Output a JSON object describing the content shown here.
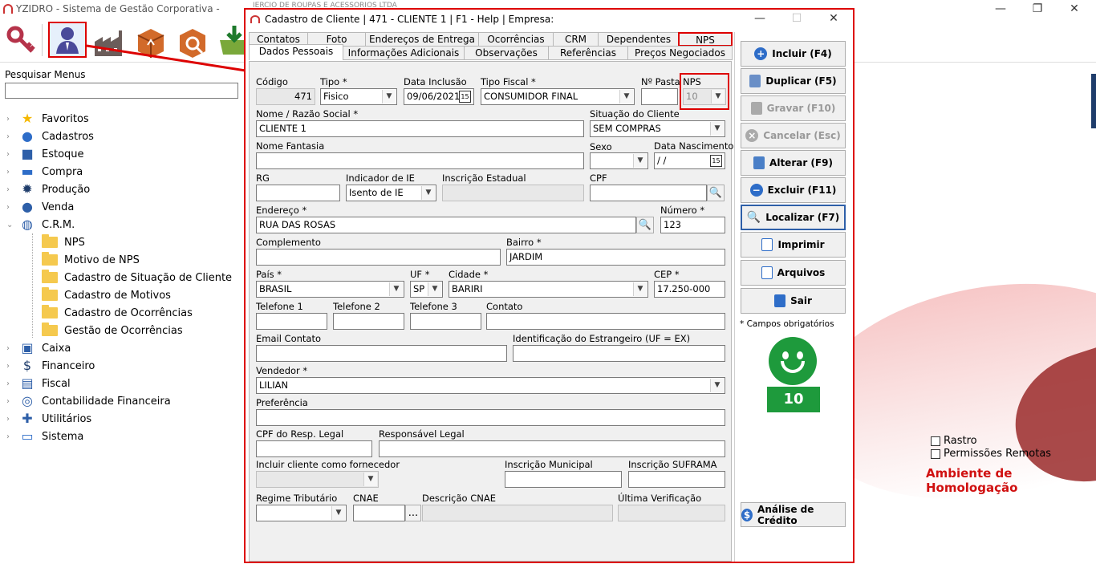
{
  "app": {
    "title": "YZIDRO - Sistema de Gestão Corporativa -",
    "company_partial": "IERCIO DE ROUPAS E ACESSORIOS LTDA"
  },
  "window_controls": {
    "minimize": "—",
    "maximize": "❐",
    "close": "✕"
  },
  "toolbar": {
    "icons": [
      "key-icon",
      "user-icon",
      "factory-icon",
      "boxes-icon",
      "tools-icon",
      "cart-download-icon"
    ]
  },
  "left_panel": {
    "search_label": "Pesquisar Menus",
    "search_value": "",
    "tree": [
      {
        "label": "Favoritos",
        "icon": "star-icon"
      },
      {
        "label": "Cadastros",
        "icon": "person-icon"
      },
      {
        "label": "Estoque",
        "icon": "box-icon"
      },
      {
        "label": "Compra",
        "icon": "basket-icon"
      },
      {
        "label": "Produção",
        "icon": "gear-icon"
      },
      {
        "label": "Venda",
        "icon": "money-bag-icon"
      },
      {
        "label": "C.R.M.",
        "icon": "globe-icon"
      },
      {
        "label": "NPS",
        "icon": "folder-icon"
      },
      {
        "label": "Motivo de NPS",
        "icon": "folder-icon"
      },
      {
        "label": "Cadastro de Situação de Cliente",
        "icon": "folder-icon"
      },
      {
        "label": "Cadastro de Motivos",
        "icon": "folder-icon"
      },
      {
        "label": "Cadastro de Ocorrências",
        "icon": "folder-icon"
      },
      {
        "label": "Gestão de Ocorrências",
        "icon": "folder-icon"
      },
      {
        "label": "Caixa",
        "icon": "register-icon"
      },
      {
        "label": "Financeiro",
        "icon": "dollar-icon"
      },
      {
        "label": "Fiscal",
        "icon": "document-icon"
      },
      {
        "label": "Contabilidade Financeira",
        "icon": "coins-icon"
      },
      {
        "label": "Utilitários",
        "icon": "wrench-icon"
      },
      {
        "label": "Sistema",
        "icon": "monitor-icon"
      }
    ]
  },
  "right_panel": {
    "rastro_label": "Rastro",
    "permissoes_label": "Permissões Remotas",
    "ambiente": "Ambiente de Homologação"
  },
  "dialog": {
    "title": "Cadastro de Cliente | 471 - CLIENTE 1 | F1 - Help | Empresa:",
    "tabs_row1": [
      "Contatos",
      "Foto",
      "Endereços de Entrega",
      "Ocorrências",
      "CRM",
      "Dependentes",
      "NPS"
    ],
    "tabs_row2": [
      "Dados Pessoais",
      "Informações Adicionais",
      "Observações",
      "Referências",
      "Preços Negociados"
    ],
    "fields": {
      "codigo": {
        "label": "Código",
        "value": "471"
      },
      "tipo": {
        "label": "Tipo *",
        "value": "Fisico"
      },
      "data_inclusao": {
        "label": "Data Inclusão",
        "value": "09/06/2021"
      },
      "tipo_fiscal": {
        "label": "Tipo Fiscal *",
        "value": "CONSUMIDOR FINAL"
      },
      "n_pasta": {
        "label": "Nº Pasta",
        "value": ""
      },
      "nps": {
        "label": "NPS",
        "value": "10"
      },
      "nome": {
        "label": "Nome / Razão Social *",
        "value": "CLIENTE 1"
      },
      "situacao": {
        "label": "Situação do Cliente",
        "value": "SEM COMPRAS"
      },
      "nome_fantasia": {
        "label": "Nome Fantasia",
        "value": ""
      },
      "sexo": {
        "label": "Sexo",
        "value": ""
      },
      "data_nascimento": {
        "label": "Data Nascimento",
        "value": " /  /"
      },
      "rg": {
        "label": "RG",
        "value": ""
      },
      "indicador_ie": {
        "label": "Indicador de IE",
        "value": "Isento de IE"
      },
      "inscricao_estadual": {
        "label": "Inscrição Estadual",
        "value": ""
      },
      "cpf": {
        "label": "CPF",
        "value": ""
      },
      "endereco": {
        "label": "Endereço *",
        "value": "RUA DAS ROSAS"
      },
      "numero": {
        "label": "Número *",
        "value": "123"
      },
      "complemento": {
        "label": "Complemento",
        "value": ""
      },
      "bairro": {
        "label": "Bairro *",
        "value": "JARDIM"
      },
      "pais": {
        "label": "País *",
        "value": "BRASIL"
      },
      "uf": {
        "label": "UF *",
        "value": "SP"
      },
      "cidade": {
        "label": "Cidade *",
        "value": "BARIRI"
      },
      "cep": {
        "label": "CEP *",
        "value": "17.250-000"
      },
      "telefone1": {
        "label": "Telefone 1",
        "value": ""
      },
      "telefone2": {
        "label": "Telefone 2",
        "value": ""
      },
      "telefone3": {
        "label": "Telefone 3",
        "value": ""
      },
      "contato": {
        "label": "Contato",
        "value": ""
      },
      "email_contato": {
        "label": "Email Contato",
        "value": ""
      },
      "id_estrangeiro": {
        "label": "Identificação do Estrangeiro (UF = EX)",
        "value": ""
      },
      "vendedor": {
        "label": "Vendedor *",
        "value": "LILIAN"
      },
      "preferencia": {
        "label": "Preferência",
        "value": ""
      },
      "cpf_resp": {
        "label": "CPF do Resp. Legal",
        "value": ""
      },
      "responsavel": {
        "label": "Responsável Legal",
        "value": ""
      },
      "incluir_fornecedor": {
        "label": "Incluir cliente como fornecedor",
        "value": ""
      },
      "inscricao_municipal": {
        "label": "Inscrição Municipal",
        "value": ""
      },
      "inscricao_suframa": {
        "label": "Inscrição SUFRAMA",
        "value": ""
      },
      "regime": {
        "label": "Regime Tributário",
        "value": ""
      },
      "cnae": {
        "label": "CNAE",
        "value": ""
      },
      "descricao_cnae": {
        "label": "Descrição CNAE",
        "value": ""
      },
      "ultima_verificacao": {
        "label": "Última Verificação",
        "value": ""
      }
    },
    "ellipsis": "...",
    "buttons": {
      "incluir": "Incluir (F4)",
      "duplicar": "Duplicar (F5)",
      "gravar": "Gravar (F10)",
      "cancelar": "Cancelar (Esc)",
      "alterar": "Alterar (F9)",
      "excluir": "Excluir (F11)",
      "localizar": "Localizar (F7)",
      "imprimir": "Imprimir",
      "arquivos": "Arquivos",
      "sair": "Sair",
      "analise": "Análise de Crédito"
    },
    "campos_obrigatorios": "* Campos obrigatórios",
    "nps_score": "10",
    "nps_color": "#1e9a3c"
  }
}
